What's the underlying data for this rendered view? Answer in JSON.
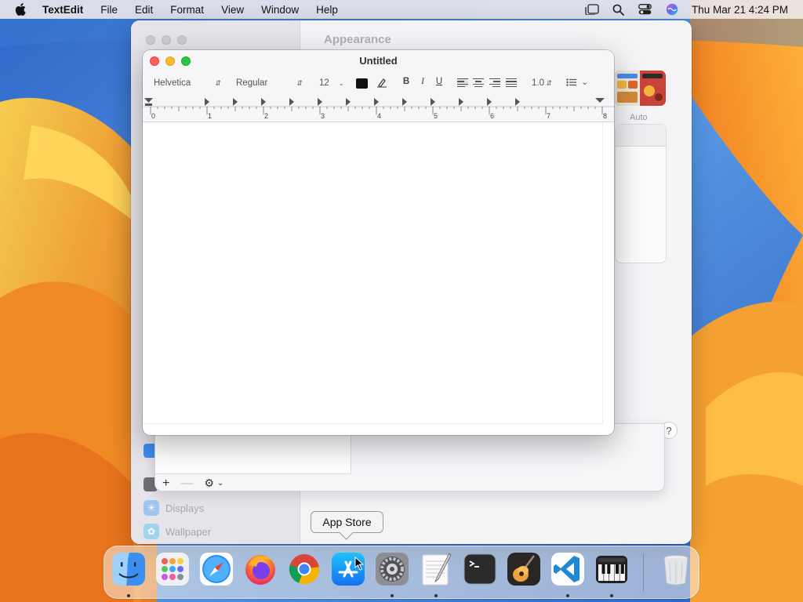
{
  "menubar": {
    "app_name": "TextEdit",
    "menus": [
      "File",
      "Edit",
      "Format",
      "View",
      "Window",
      "Help"
    ],
    "clock": "Thu Mar 21  4:24 PM",
    "status_icons": [
      "stage-manager-icon",
      "spotlight-search-icon",
      "control-center-icon",
      "siri-icon"
    ]
  },
  "settings_window": {
    "title": "Appearance",
    "auto_label": "Auto",
    "help_label": "?",
    "sidebar": [
      {
        "label": "Displays",
        "icon": "sun-icon"
      },
      {
        "label": "Wallpaper",
        "icon": "flower-icon"
      }
    ],
    "sheet_toolbar": {
      "add": "+",
      "remove": "—",
      "action": "⚙"
    }
  },
  "textedit": {
    "title": "Untitled",
    "font_family": "Helvetica",
    "font_style": "Regular",
    "font_size": "12",
    "bold": "B",
    "italic": "I",
    "underline": "U",
    "line_spacing": "1.0",
    "text_color": "#111111",
    "alignment_selected": "left",
    "ruler_numbers": [
      "0",
      "1",
      "2",
      "3",
      "4",
      "5",
      "6",
      "7",
      "8"
    ],
    "document_text": ""
  },
  "tooltip": {
    "text": "App Store"
  },
  "dock": {
    "apps": [
      {
        "name": "Finder",
        "running": true
      },
      {
        "name": "Launchpad",
        "running": false
      },
      {
        "name": "Safari",
        "running": false
      },
      {
        "name": "Firefox",
        "running": false
      },
      {
        "name": "Google Chrome",
        "running": false
      },
      {
        "name": "App Store",
        "running": false
      },
      {
        "name": "System Settings",
        "running": true
      },
      {
        "name": "TextEdit",
        "running": true
      },
      {
        "name": "Terminal",
        "running": false
      },
      {
        "name": "GarageBand",
        "running": false
      },
      {
        "name": "Visual Studio Code",
        "running": true
      },
      {
        "name": "Piano",
        "running": true
      },
      {
        "name": "Trash",
        "running": false
      }
    ]
  },
  "colors": {
    "close": "#fe5f57",
    "minimize": "#febc2e",
    "maximize": "#28c840",
    "wallpaper_orange": "#f39a2a",
    "wallpaper_blue": "#3d7fd6"
  }
}
